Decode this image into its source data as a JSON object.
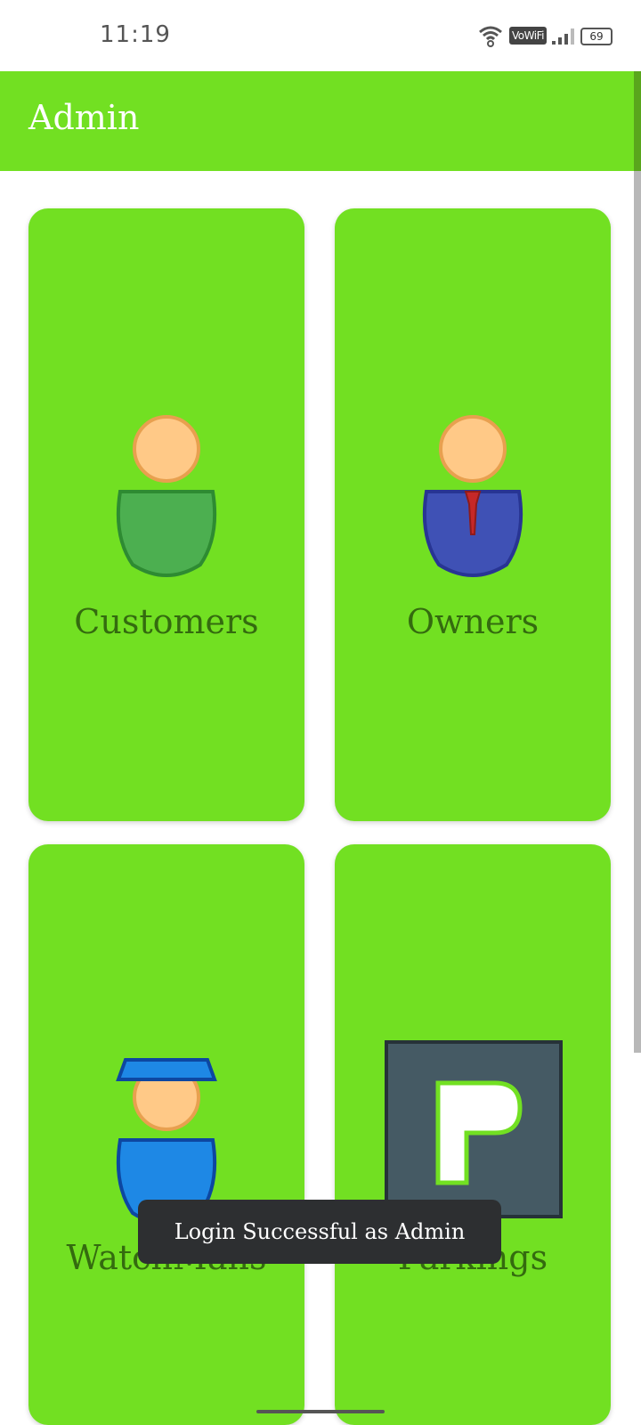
{
  "status_bar": {
    "time": "11:19",
    "vowifi_label": "VoWiFi",
    "battery_level": "69"
  },
  "app_bar": {
    "title": "Admin"
  },
  "cards": [
    {
      "label": "Customers",
      "icon": "customer-icon"
    },
    {
      "label": "Owners",
      "icon": "owner-icon"
    },
    {
      "label": "WatchMans",
      "icon": "watchman-icon"
    },
    {
      "label": "Parkings",
      "icon": "parking-icon"
    }
  ],
  "toast": {
    "message": "Login Successful as Admin"
  },
  "colors": {
    "accent": "#72e022",
    "label": "#346b0f",
    "toast_bg": "#2d2f31"
  }
}
